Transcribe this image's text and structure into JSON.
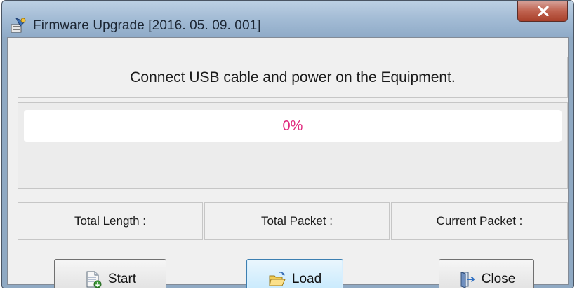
{
  "window": {
    "title": "Firmware Upgrade [2016. 05. 09. 001]",
    "close_icon": "close-x-icon",
    "app_icon": "firmware-app-icon"
  },
  "message": "Connect USB cable and power on the Equipment.",
  "progress": {
    "text": "0%",
    "value_percent": 0,
    "text_color": "#e0287d"
  },
  "stats": {
    "total_length": "Total Length :",
    "total_packet": "Total Packet :",
    "current_packet": "Current Packet :"
  },
  "buttons": {
    "start": {
      "label": "Start",
      "mnemonic": "S",
      "icon": "document-download-icon"
    },
    "load": {
      "label": "Load",
      "mnemonic": "L",
      "icon": "open-folder-icon"
    },
    "close": {
      "label": "Close",
      "mnemonic": "C",
      "icon": "exit-door-icon"
    }
  },
  "colors": {
    "titlebar": "#a5bdd6",
    "close_button": "#c06350",
    "focused_button_border": "#3c7fb1"
  }
}
